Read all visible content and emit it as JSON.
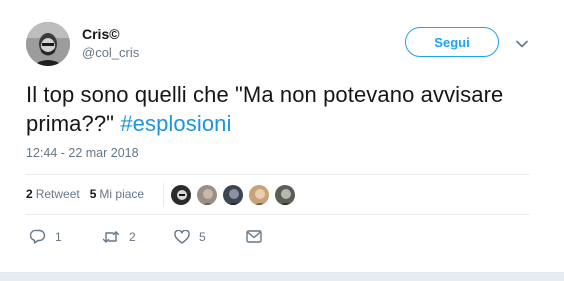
{
  "user": {
    "name": "Cris©",
    "handle": "@col_cris"
  },
  "follow": {
    "label": "Segui"
  },
  "tweet": {
    "text_before": "Il top sono quelli che \"Ma non potevano avvisare prima??\" ",
    "hashtag": "#esplosioni",
    "timestamp": "12:44 - 22 mar 2018"
  },
  "stats": {
    "retweet_count": "2",
    "retweet_label": "Retweet",
    "like_count": "5",
    "like_label": "Mi piace"
  },
  "likers": [
    {
      "color": "#2b2b2b"
    },
    {
      "color": "#9a8f86"
    },
    {
      "color": "#3d4452"
    },
    {
      "color": "#c8a37a"
    },
    {
      "color": "#5a5f55"
    }
  ],
  "actions": {
    "reply_count": "1",
    "retweet_count": "2",
    "like_count": "5"
  },
  "colors": {
    "accent": "#1da1f2",
    "hashtag": "#1b95e0",
    "secondary_text": "#657786"
  }
}
